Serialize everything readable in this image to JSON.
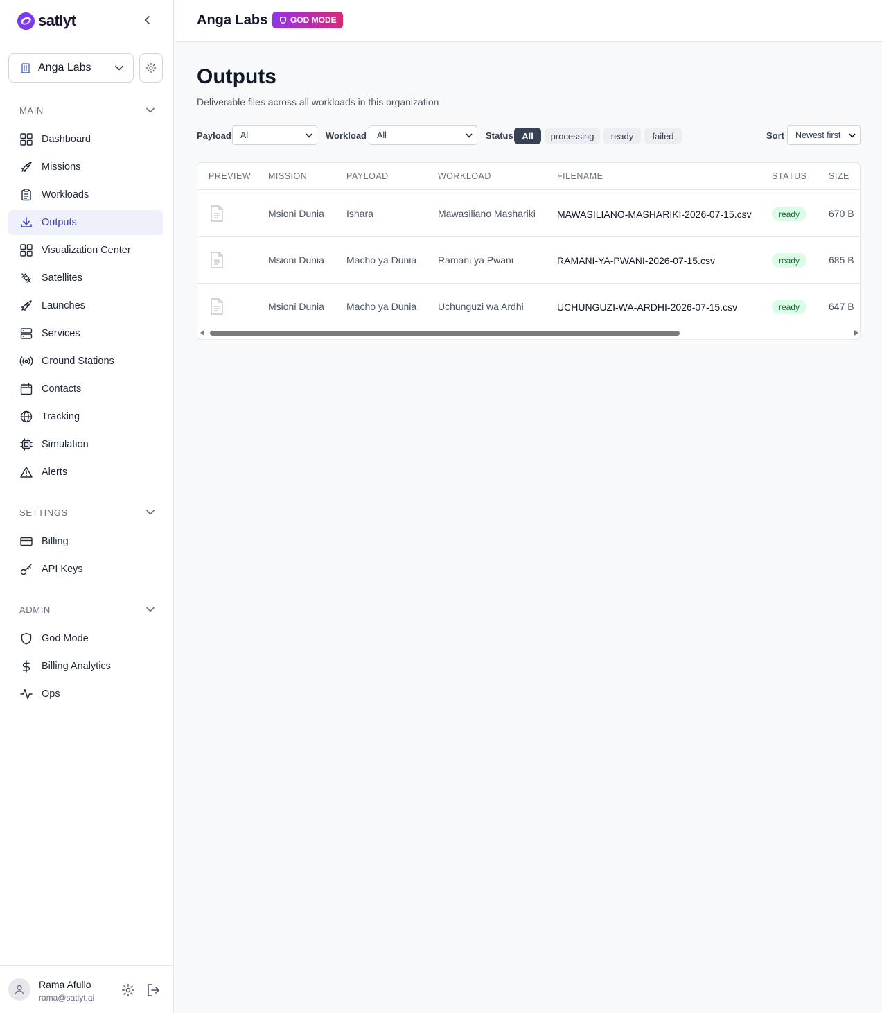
{
  "brand": {
    "name": "satlyt"
  },
  "org_switcher": {
    "label": "Anga Labs"
  },
  "sidebar": {
    "main_heading": "MAIN",
    "main_items": [
      {
        "label": "Dashboard",
        "icon": "grid-icon"
      },
      {
        "label": "Missions",
        "icon": "rocket-icon"
      },
      {
        "label": "Workloads",
        "icon": "clipboard-icon"
      },
      {
        "label": "Outputs",
        "icon": "download-icon",
        "active": true
      },
      {
        "label": "Visualization Center",
        "icon": "grid-icon"
      },
      {
        "label": "Satellites",
        "icon": "satellite-icon"
      },
      {
        "label": "Launches",
        "icon": "rocket-icon"
      },
      {
        "label": "Services",
        "icon": "server-icon"
      },
      {
        "label": "Ground Stations",
        "icon": "radio-icon"
      },
      {
        "label": "Contacts",
        "icon": "calendar-icon"
      },
      {
        "label": "Tracking",
        "icon": "globe-icon"
      },
      {
        "label": "Simulation",
        "icon": "cpu-icon"
      },
      {
        "label": "Alerts",
        "icon": "alert-triangle-icon"
      }
    ],
    "settings_heading": "SETTINGS",
    "settings_items": [
      {
        "label": "Billing",
        "icon": "credit-card-icon"
      },
      {
        "label": "API Keys",
        "icon": "key-icon"
      }
    ],
    "admin_heading": "ADMIN",
    "admin_items": [
      {
        "label": "God Mode",
        "icon": "shield-icon"
      },
      {
        "label": "Billing Analytics",
        "icon": "dollar-icon"
      },
      {
        "label": "Ops",
        "icon": "activity-icon"
      }
    ]
  },
  "user": {
    "name": "Rama Afullo",
    "email": "rama@satlyt.ai"
  },
  "topbar": {
    "org_title": "Anga Labs",
    "badge": "GOD MODE"
  },
  "page": {
    "title": "Outputs",
    "subtitle": "Deliverable files across all workloads in this organization"
  },
  "filters": {
    "payload_label": "Payload",
    "payload_value": "All",
    "workload_label": "Workload",
    "workload_value": "All",
    "status_label": "Status",
    "status_options": [
      "All",
      "processing",
      "ready",
      "failed"
    ],
    "status_selected": "All",
    "sort_label": "Sort",
    "sort_value": "Newest first"
  },
  "table": {
    "columns": [
      "PREVIEW",
      "MISSION",
      "PAYLOAD",
      "WORKLOAD",
      "FILENAME",
      "STATUS",
      "SIZE"
    ],
    "rows": [
      {
        "mission": "Msioni Dunia",
        "payload": "Ishara",
        "workload": "Mawasiliano Mashariki",
        "filename": "MAWASILIANO-MASHARIKI-2026-07-15.csv",
        "status": "ready",
        "size": "670 B"
      },
      {
        "mission": "Msioni Dunia",
        "payload": "Macho ya Dunia",
        "workload": "Ramani ya Pwani",
        "filename": "RAMANI-YA-PWANI-2026-07-15.csv",
        "status": "ready",
        "size": "685 B"
      },
      {
        "mission": "Msioni Dunia",
        "payload": "Macho ya Dunia",
        "workload": "Uchunguzi wa Ardhi",
        "filename": "UCHUNGUZI-WA-ARDHI-2026-07-15.csv",
        "status": "ready",
        "size": "647 B"
      }
    ]
  },
  "colors": {
    "accent": "#3b3fb8",
    "brand_purple": "#7c3aed",
    "badge_gradient_start": "#9333ea",
    "badge_gradient_end": "#db2777",
    "ready_bg": "#dcfce7",
    "ready_text": "#166534"
  }
}
